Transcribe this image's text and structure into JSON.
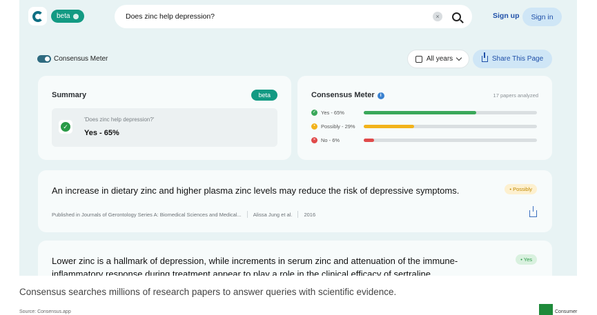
{
  "header": {
    "beta_label": "beta",
    "search_value": "Does zinc help depression?",
    "signup_label": "Sign up",
    "signin_label": "Sign in"
  },
  "controls": {
    "meter_toggle_label": "Consensus Meter",
    "years_label": "All years",
    "share_label": "Share This Page"
  },
  "summary": {
    "title": "Summary",
    "badge": "beta",
    "question": "'Does zinc help depression?'",
    "answer": "Yes - 65%"
  },
  "meter": {
    "title": "Consensus Meter",
    "analyzed": "17 papers analyzed",
    "rows": [
      {
        "label": "Yes - 65%",
        "percent": 65,
        "color": "#3aa85a",
        "icon": "check-icon",
        "glyph": "✓"
      },
      {
        "label": "Possibly - 29%",
        "percent": 29,
        "color": "#f2b31b",
        "icon": "dot-icon",
        "glyph": "•"
      },
      {
        "label": "No - 6%",
        "percent": 6,
        "color": "#e04a4a",
        "icon": "x-icon",
        "glyph": "×"
      }
    ]
  },
  "results": [
    {
      "title": "An increase in dietary zinc and higher plasma zinc levels may reduce the risk of depressive symptoms.",
      "tag": "• Possibly",
      "tag_bg": "#fdf0cf",
      "tag_color": "#c28a00",
      "journal": "Published in Journals of Gerontology Series A: Biomedical Sciences and Medical...",
      "authors": "Alissa Jung et al.",
      "year": "2016"
    },
    {
      "title": "Lower zinc is a hallmark of depression, while increments in serum zinc and attenuation of the immune-inflammatory response during treatment appear to play a role in the clinical efficacy of sertraline.",
      "tag": "• Yes",
      "tag_bg": "#d9f1df",
      "tag_color": "#2a9a47"
    }
  ],
  "caption": "Consensus searches millions of research papers to answer queries with scientific evidence.",
  "source": "Source: Consensus.app",
  "corner_text": "Consumer"
}
